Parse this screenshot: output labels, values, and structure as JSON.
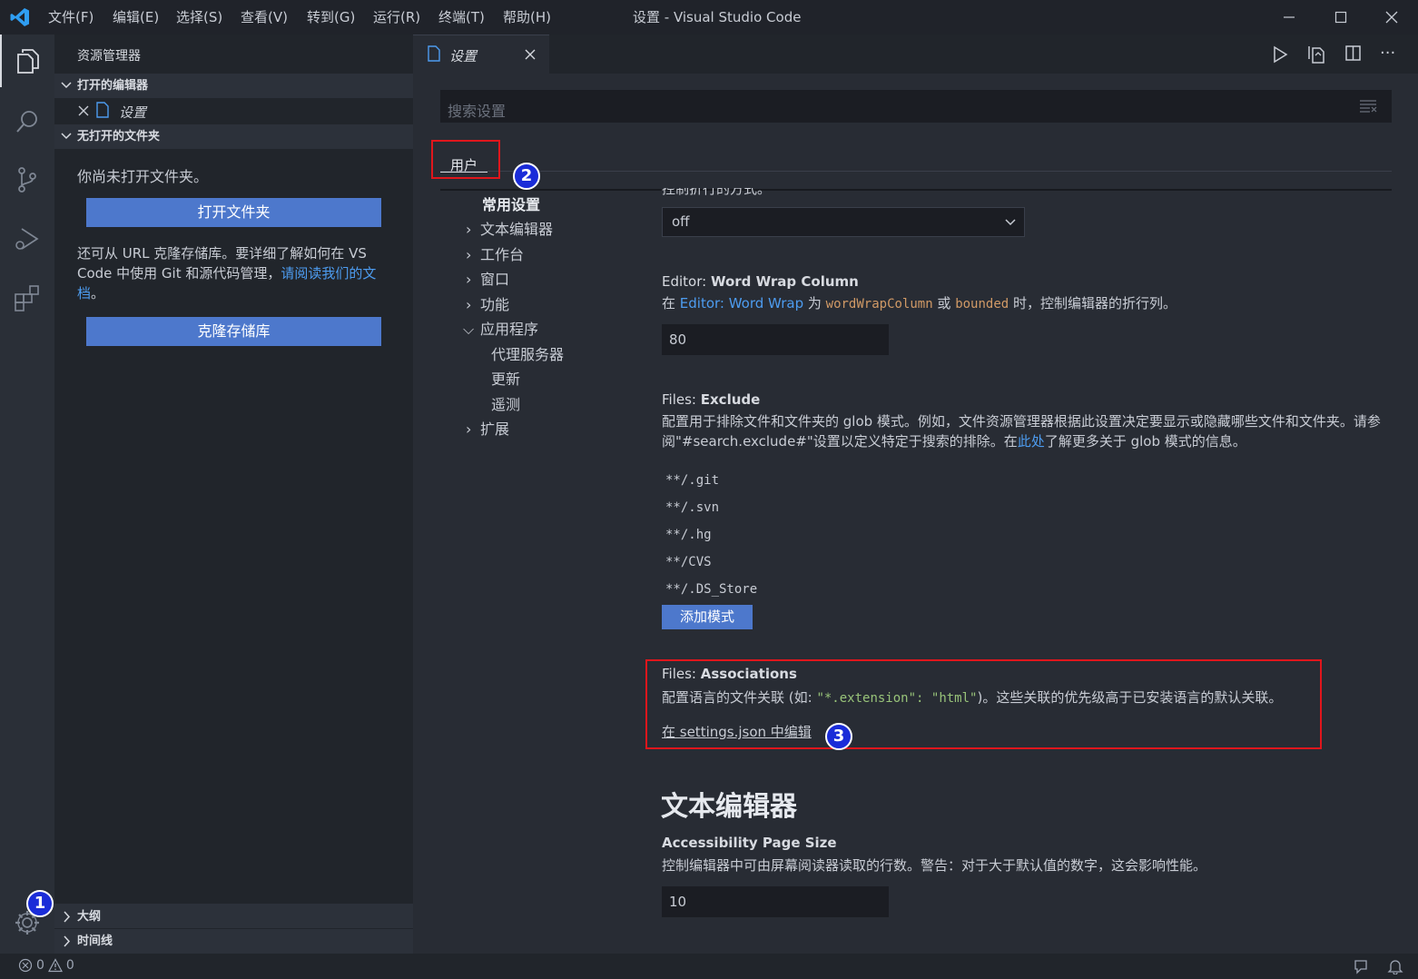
{
  "titlebar": {
    "menu": [
      "文件(F)",
      "编辑(E)",
      "选择(S)",
      "查看(V)",
      "转到(G)",
      "运行(R)",
      "终端(T)",
      "帮助(H)"
    ],
    "window_title": "设置 - Visual Studio Code"
  },
  "sidebar": {
    "title": "资源管理器",
    "open_editors_header": "打开的编辑器",
    "open_editor_item": "设置",
    "no_folder_header": "无打开的文件夹",
    "no_folder_text": "你尚未打开文件夹。",
    "open_folder_button": "打开文件夹",
    "clone_text_1": "还可从 URL 克隆存储库。要详细了解如何在 VS Code 中使用 Git 和源代码管理，",
    "clone_link": "请阅读我们的文档",
    "clone_text_end": "。",
    "clone_button": "克隆存储库",
    "outline_header": "大纲",
    "timeline_header": "时间线"
  },
  "tab": {
    "label": "设置"
  },
  "settings": {
    "search_placeholder": "搜索设置",
    "scope_tab": "用户",
    "toc": {
      "common": "常用设置",
      "items": [
        "文本编辑器",
        "工作台",
        "窗口",
        "功能",
        "应用程序"
      ],
      "app_children": [
        "代理服务器",
        "更新",
        "遥测"
      ],
      "last": "扩展"
    },
    "cut_text": "控制折行的方式。",
    "word_wrap_value": "off",
    "wrap_col": {
      "prefix": "Editor: ",
      "name": "Word Wrap Column",
      "desc_1": "在 ",
      "desc_link": "Editor: Word Wrap",
      "desc_2": " 为 ",
      "desc_code1": "wordWrapColumn",
      "desc_3": " 或 ",
      "desc_code2": "bounded",
      "desc_4": " 时，控制编辑器的折行列。",
      "value": "80"
    },
    "exclude": {
      "prefix": "Files: ",
      "name": "Exclude",
      "desc_1": "配置用于排除文件和文件夹的 glob 模式。例如，文件资源管理器根据此设置决定要显示或隐藏哪些文件和文件夹。请参阅\"#search.exclude#\"设置以定义特定于搜索的排除。在",
      "desc_link": "此处",
      "desc_2": "了解更多关于 glob 模式的信息。",
      "patterns": [
        "**/.git",
        "**/.svn",
        "**/.hg",
        "**/CVS",
        "**/.DS_Store"
      ],
      "add_button": "添加模式"
    },
    "assoc": {
      "prefix": "Files: ",
      "name": "Associations",
      "desc_1": "配置语言的文件关联 (如: ",
      "desc_code1": "\"*.extension\": \"html\"",
      "desc_2": ")。这些关联的优先级高于已安装语言的默认关联。",
      "edit_link": "在 settings.json 中编辑"
    },
    "section_heading": "文本编辑器",
    "page_size": {
      "name": "Accessibility Page Size",
      "desc": "控制编辑器中可由屏幕阅读器读取的行数。警告：对于大于默认值的数字，这会影响性能。",
      "value": "10"
    }
  },
  "badges": [
    "1",
    "2",
    "3"
  ],
  "status": {
    "errors": "0",
    "warnings": "0"
  }
}
